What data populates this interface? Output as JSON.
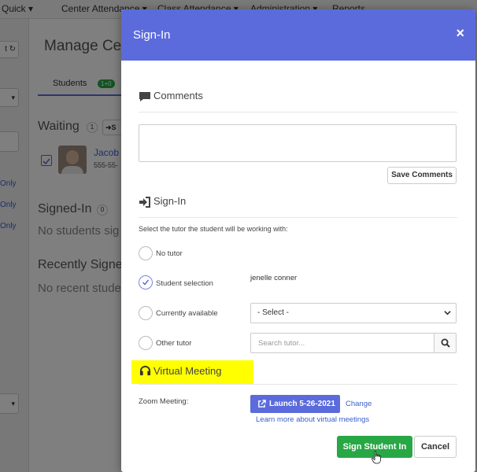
{
  "background": {
    "nav": [
      "Quick",
      "Center Attendance",
      "Class Attendance",
      "Administration",
      "Reports"
    ],
    "page_title": "Manage Ce",
    "tab_label": "Students",
    "tab_badge": "1+0",
    "waiting_heading": "Waiting",
    "waiting_count": "1",
    "waiting_button": "S",
    "student_name": "Jacob",
    "student_phone": "555-55-",
    "signed_in_heading": "Signed-In",
    "signed_in_count": "0",
    "signed_in_empty": "No students sig",
    "recent_heading": "Recently Signe",
    "recent_empty": "No recent stude",
    "left_only_labels": [
      "Only",
      "Only",
      "Only"
    ]
  },
  "modal": {
    "title": "Sign-In",
    "close_symbol": "×",
    "comments": {
      "heading": "Comments",
      "value": "",
      "save_label": "Save Comments"
    },
    "signin": {
      "heading": "Sign-In",
      "instruction": "Select the tutor the student will be working with:",
      "options": [
        {
          "label": "No tutor",
          "checked": false
        },
        {
          "label": "Student selection",
          "checked": true
        },
        {
          "label": "Currently available",
          "checked": false
        },
        {
          "label": "Other tutor",
          "checked": false
        }
      ],
      "student_selection_value": "jenelle conner",
      "select_value": "- Select -",
      "search_placeholder": "Search tutor..."
    },
    "virtual_meeting": {
      "heading": "Virtual Meeting",
      "zoom_label": "Zoom Meeting:",
      "launch_label": "Launch 5-26-2021",
      "change_label": "Change",
      "learn_more": "Learn more about virtual meetings"
    },
    "footer": {
      "sign_in_label": "Sign Student In",
      "cancel_label": "Cancel"
    }
  },
  "colors": {
    "header": "#5b6bdc",
    "primary": "#5b6bdc",
    "success": "#28a745",
    "highlight": "#ffff00",
    "link": "#3a5fcd"
  },
  "icons": [
    "comment-icon",
    "sign-in-icon",
    "headset-icon",
    "close-icon",
    "check-icon",
    "chevron-down-icon",
    "search-icon",
    "external-link-icon",
    "hand-cursor-icon"
  ]
}
